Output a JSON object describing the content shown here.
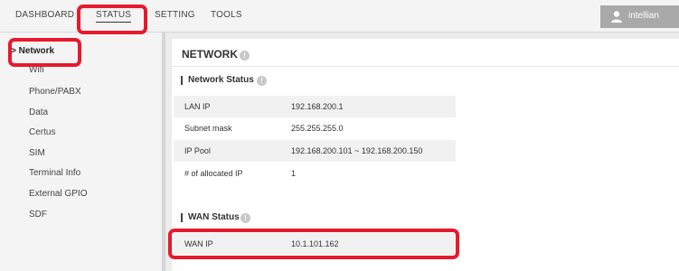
{
  "topnav": {
    "tabs": [
      {
        "label": "DASHBOARD"
      },
      {
        "label": "STATUS"
      },
      {
        "label": "SETTING"
      },
      {
        "label": "TOOLS"
      }
    ],
    "user": "intellian"
  },
  "sidebar": {
    "items": [
      {
        "label": "> Network"
      },
      {
        "label": "Wifi"
      },
      {
        "label": "Phone/PABX"
      },
      {
        "label": "Data"
      },
      {
        "label": "Certus"
      },
      {
        "label": "SIM"
      },
      {
        "label": "Terminal Info"
      },
      {
        "label": "External GPIO"
      },
      {
        "label": "SDF"
      }
    ]
  },
  "main": {
    "title": "NETWORK",
    "network_status": {
      "heading": "Network Status",
      "rows": [
        {
          "label": "LAN IP",
          "value": "192.168.200.1"
        },
        {
          "label": "Subnet mask",
          "value": "255.255.255.0"
        },
        {
          "label": "IP Pool",
          "value": "192.168.200.101 ~ 192.168.200.150"
        },
        {
          "label": "# of allocated IP",
          "value": "1"
        }
      ]
    },
    "wan_status": {
      "heading": "WAN Status",
      "rows": [
        {
          "label": "WAN IP",
          "value": "10.1.101.162"
        }
      ]
    },
    "info_glyph": "!"
  },
  "colors": {
    "highlight": "#e8192c",
    "nav_bg": "#f4f4f4",
    "user_bg": "#a9a9a9"
  }
}
